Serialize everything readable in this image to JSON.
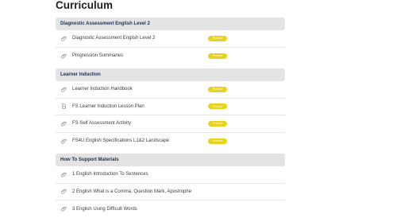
{
  "page": {
    "title": "Curriculum"
  },
  "colors": {
    "preview_badge": "#e9d21a",
    "section_header_bg": "#e3e3e3",
    "section_header_text": "#1f2f4f"
  },
  "sections": [
    {
      "title": "Diagnostic Assessment English Level 2",
      "lessons": [
        {
          "icon": "paperclip-icon",
          "title": "Diagnostic Assessment English Level 2",
          "badge": "Preview"
        },
        {
          "icon": "paperclip-icon",
          "title": "Progression Summaries",
          "badge": "Preview"
        }
      ]
    },
    {
      "title": "Learner Induction",
      "lessons": [
        {
          "icon": "paperclip-icon",
          "title": "Learner Induction Handbook",
          "badge": "Preview"
        },
        {
          "icon": "document-icon",
          "title": "FS Learner Induction Lesson Plan",
          "badge": "Preview"
        },
        {
          "icon": "paperclip-icon",
          "title": "FS Self Assessment Activity",
          "badge": "Preview"
        },
        {
          "icon": "paperclip-icon",
          "title": "FS4U English Specifications L1&2 Landscape",
          "badge": "Preview"
        }
      ]
    },
    {
      "title": "How To Support Materials",
      "lessons": [
        {
          "icon": "paperclip-icon",
          "title": "1 English Introduction To Sentences"
        },
        {
          "icon": "paperclip-icon",
          "title": "2 English What is a Comma, Question Mark, Apostrophe"
        },
        {
          "icon": "paperclip-icon",
          "title": "3 English Using Difficult Words"
        }
      ]
    }
  ]
}
